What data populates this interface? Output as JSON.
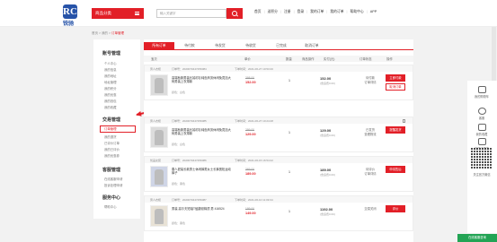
{
  "logo": {
    "mark": "RC",
    "text": "锐驰"
  },
  "header": {
    "category_label": "商品分类",
    "search_placeholder": "输入关键字",
    "nav": [
      "首页",
      "送积分",
      "注册",
      "登录",
      "我的订单",
      "我的订单",
      "帮助中心",
      "APP"
    ]
  },
  "breadcrumb": {
    "prefix": "首页",
    "sep1": ">",
    "mid": "我的",
    "sep2": ">",
    "current": "订单管理"
  },
  "sidebar": {
    "sections": [
      {
        "title": "账号管理",
        "items": [
          "个人中心",
          "我的信息",
          "我的地址",
          "地址管理",
          "我的积分",
          "我的优惠",
          "我的钱包",
          "我的收藏"
        ]
      },
      {
        "title": "交易管理",
        "items": [
          "订单管理",
          "我的退货",
          "已评价订单",
          "我的已评价",
          "我的优惠券"
        ]
      },
      {
        "title": "客服管理",
        "items": [
          "在线客服申请",
          "投诉处理申请"
        ]
      },
      {
        "title": "服务中心",
        "items": [
          "帮助中心"
        ]
      }
    ],
    "active_item": "订单管理"
  },
  "tabs": [
    "所有订单",
    "待付款",
    "待发货",
    "待收货",
    "已完成",
    "取消订单"
  ],
  "table_header": [
    "宝贝",
    "单价",
    "数量",
    "商品操作",
    "实付(元)",
    "订单状态",
    "操作"
  ],
  "orders": [
    {
      "shop": "男人衣柜",
      "order_no": "订单号：2020070447256084",
      "date": "下单时间：2021-06-27 10:53:20",
      "name": "高端秋款男装长袖衬衫纯色商务休闲免烫加大码男装上衣薄款",
      "color": "颜色：白色",
      "orig_price": "398.00",
      "price": "152.00",
      "qty": "1",
      "total": "152.00",
      "total_note": "(含运费0.00)",
      "status": "待付款\n订单详情",
      "btn1": "立即付款",
      "btn2": "取消订单"
    },
    {
      "shop": "男人衣柜",
      "order_no": "订单号：2020070447256085",
      "date": "下单时间：2021-06-27 10:24:28",
      "name": "高端秋款男装长袖衬衫纯色商务休闲免烫加大码男装上衣薄款",
      "color": "颜色：白色",
      "orig_price": "299.00",
      "price": "129.00",
      "qty": "1",
      "total": "129.00",
      "total_note": "(含运费0.00)",
      "status": "已发货\n查看物流",
      "btn1": "提醒发货",
      "btn2": ""
    },
    {
      "shop": "优品女装",
      "order_no": "订单号：2020070447256086",
      "date": "下单时间：2021-06-15 16:54:22",
      "name": "春人夏装长款男士休闲裤男女士长裤宽松运动裤子",
      "color": "颜色：黑色",
      "orig_price": "369.00",
      "price": "189.00",
      "qty": "1",
      "total": "189.00",
      "total_note": "(含运费0.00)",
      "status": "待评价\n订单详情",
      "btn1": "申请售后",
      "btn2": ""
    },
    {
      "shop": "男人衣柜",
      "order_no": "订单号：2020070447256087",
      "date": "下单时间：2021-06-10 11:09:34",
      "name": "男装 高尔夫短袖T恤翻领棉质 男 416524",
      "color": "颜色：黑色",
      "orig_price": "199.00",
      "price": "149.00",
      "qty": "1",
      "total": "1192.00",
      "total_note": "(含运费0.00)",
      "status": "交易关闭",
      "btn1": "评价",
      "btn2": ""
    }
  ],
  "right_tools": [
    "我的购物车",
    "客服",
    "我的收藏",
    "我的优惠券",
    "关注官方微信"
  ],
  "chat_label": "在线客服咨询",
  "colors": {
    "accent": "#e21f27",
    "brand": "#2753a8",
    "chat": "#23a455"
  }
}
